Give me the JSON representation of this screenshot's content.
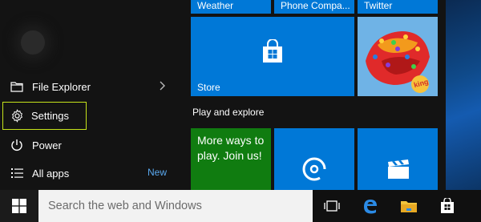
{
  "left_menu": {
    "items": [
      {
        "label": "File Explorer",
        "icon": "folder-icon"
      },
      {
        "label": "Settings",
        "icon": "gear-icon"
      },
      {
        "label": "Power",
        "icon": "power-icon"
      },
      {
        "label": "All apps",
        "icon": "list-icon",
        "badge": "New"
      }
    ]
  },
  "tiles": {
    "top_row": [
      {
        "label": "Weather"
      },
      {
        "label": "Phone Compa..."
      },
      {
        "label": "Twitter"
      }
    ],
    "store": {
      "label": "Store",
      "icon": "store-bag-icon"
    },
    "candy": {
      "icon": "candy-crush-icon",
      "logo_text": "king"
    },
    "section_title": "Play and explore",
    "more_ways": {
      "label": "More ways to play. Join us!"
    },
    "groove": {
      "icon": "groove-music-icon"
    },
    "movies": {
      "icon": "clapperboard-icon"
    }
  },
  "taskbar": {
    "search_placeholder": "Search the web and Windows",
    "icons": [
      "windows-logo-icon",
      "task-view-icon",
      "edge-icon",
      "file-explorer-icon",
      "store-icon"
    ]
  },
  "colors": {
    "tile_blue": "#0078d7",
    "xbox_green": "#107c10",
    "highlight": "#c6e31b",
    "accent_text": "#5aa9f0"
  }
}
